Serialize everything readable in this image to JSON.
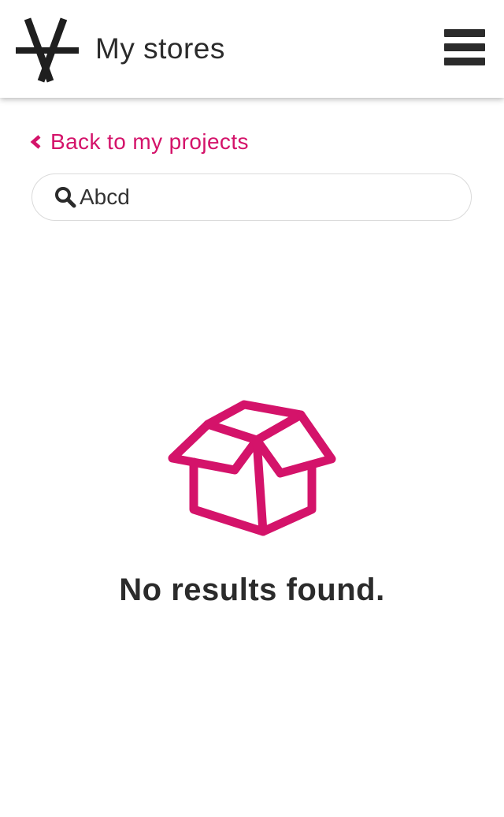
{
  "header": {
    "title": "My stores",
    "logo_icon": "star-asterisk-logo-icon",
    "menu_icon": "hamburger-menu-icon"
  },
  "nav": {
    "back_label": "Back to my projects",
    "back_icon": "chevron-left-icon"
  },
  "search": {
    "value": "Abcd",
    "icon": "search-icon"
  },
  "empty_state": {
    "icon": "open-box-icon",
    "message": "No results found."
  },
  "colors": {
    "accent": "#d4136a",
    "text": "#2b2b2b",
    "border": "#dadada",
    "background": "#ffffff"
  }
}
